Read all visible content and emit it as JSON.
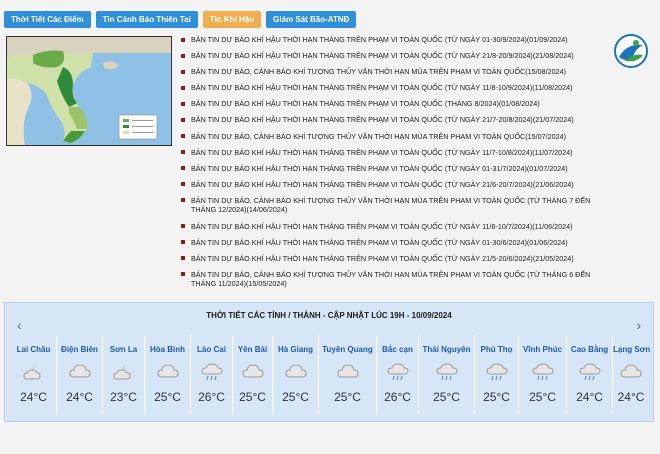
{
  "tabs": [
    "Thời Tiết Các Điểm",
    "Tin Cảnh Báo Thiên Tai",
    "Tin Khí Hậu",
    "Giám Sát Bão-ATNĐ"
  ],
  "news": [
    "BẢN TIN DỰ BÁO KHÍ HẬU THỜI HẠN THÁNG TRÊN PHẠM VI TOÀN QUỐC (TỪ NGÀY 01-30/9/2024)(01/09/2024)",
    "BẢN TIN DỰ BÁO KHÍ HẬU THỜI HẠN THÁNG TRÊN PHẠM VI TOÀN QUỐC (TỪ NGÀY 21/8-20/9/2024)(21/08/2024)",
    "BẢN TIN DỰ BÁO, CẢNH BÁO KHÍ TƯỢNG THỦY VĂN THỜI HẠN MÙA TRÊN PHẠM VI TOÀN QUỐC(15/08/2024)",
    "BẢN TIN DỰ BÁO KHÍ HẬU THỜI HẠN THÁNG TRÊN PHẠM VI TOÀN QUỐC (TỪ NGÀY 11/8-10/9/2024)(11/08/2024)",
    "BẢN TIN DỰ BÁO KHÍ HẬU THỜI HẠN THÁNG TRÊN PHẠM VI TOÀN QUỐC (THÁNG 8/2024)(01/08/2024)",
    "BẢN TIN DỰ BÁO KHÍ HẬU THỜI HẠN THÁNG TRÊN PHẠM VI TOÀN QUỐC (TỪ NGÀY 21/7-20/8/2024)(21/07/2024)",
    "BẢN TIN DỰ BÁO, CẢNH BÁO KHÍ TƯỢNG THỦY VĂN THỜI HẠN MÙA TRÊN PHẠM VI TOÀN QUỐC(15/07/2024)",
    "BẢN TIN DỰ BÁO KHÍ HẬU THỜI HẠN THÁNG TRÊN PHẠM VI TOÀN QUỐC (TỪ NGÀY 11/7-10/8/2024)(11/07/2024)",
    "BẢN TIN DỰ BÁO KHÍ HẬU THỜI HẠN THÁNG TRÊN PHẠM VI TOÀN QUỐC (TỪ NGÀY 01-31/7/2024)(01/07/2024)",
    "BẢN TIN DỰ BÁO KHÍ HẬU THỜI HẠN THÁNG TRÊN PHẠM VI TOÀN QUỐC (TỪ NGÀY 21/6-20/7/2024)(21/06/2024)",
    "BẢN TIN DỰ BÁO, CẢNH BÁO KHÍ TƯỢNG THỦY VĂN THỜI HẠN MÙA TRÊN PHẠM VI TOÀN QUỐC (TỪ THÁNG 7 ĐẾN THÁNG 12/2024)(14/06/2024)",
    "BẢN TIN DỰ BÁO KHÍ HẬU THỜI HẠN THÁNG TRÊN PHẠM VI TOÀN QUỐC (TỪ NGÀY 11/6-10/7/2024)(11/06/2024)",
    "BẢN TIN DỰ BÁO KHÍ HẬU THỜI HẠN THÁNG TRÊN PHẠM VI TOÀN QUỐC (TỪ NGÀY 01-30/6/2024)(01/06/2024)",
    "BẢN TIN DỰ BÁO KHÍ HẬU THỜI HẠN THÁNG TRÊN PHẠM VI TOÀN QUỐC (TỪ NGÀY 21/5-20/6/2024)(21/05/2024)",
    "BẢN TIN DỰ BÁO, CẢNH BÁO KHÍ TƯỢNG THỦY VĂN THỜI HẠN MÙA TRÊN PHẠM VI TOÀN QUỐC (TỪ THÁNG 6 ĐẾN THÁNG 11/2024)(15/05/2024)"
  ],
  "weather": {
    "title": "THỜI TIẾT CÁC TỈNH / THÀNH - CẬP NHẬT LÚC 19H - 10/09/2024",
    "arrow_left": "‹",
    "arrow_right": "›",
    "cities": [
      {
        "name": "Lai Châu",
        "temp": "24°C",
        "icon": "cloud-moon-icon"
      },
      {
        "name": "Điện Biên",
        "temp": "24°C",
        "icon": "cloud-icon"
      },
      {
        "name": "Sơn La",
        "temp": "23°C",
        "icon": "cloud-moon-icon"
      },
      {
        "name": "Hòa Bình",
        "temp": "25°C",
        "icon": "cloud-icon"
      },
      {
        "name": "Lào Cai",
        "temp": "26°C",
        "icon": "rain-cloud-icon"
      },
      {
        "name": "Yên Bái",
        "temp": "25°C",
        "icon": "cloud-icon"
      },
      {
        "name": "Hà Giang",
        "temp": "25°C",
        "icon": "cloud-icon"
      },
      {
        "name": "Tuyên Quang",
        "temp": "25°C",
        "icon": "cloud-icon"
      },
      {
        "name": "Bắc cạn",
        "temp": "26°C",
        "icon": "rain-cloud-icon"
      },
      {
        "name": "Thái Nguyên",
        "temp": "25°C",
        "icon": "rain-cloud-icon"
      },
      {
        "name": "Phú Thọ",
        "temp": "25°C",
        "icon": "rain-cloud-icon"
      },
      {
        "name": "Vĩnh Phúc",
        "temp": "25°C",
        "icon": "rain-cloud-icon"
      },
      {
        "name": "Cao Bằng",
        "temp": "24°C",
        "icon": "rain-cloud-icon"
      },
      {
        "name": "Lạng Sơn",
        "temp": "24°C",
        "icon": "cloud-icon"
      }
    ]
  }
}
